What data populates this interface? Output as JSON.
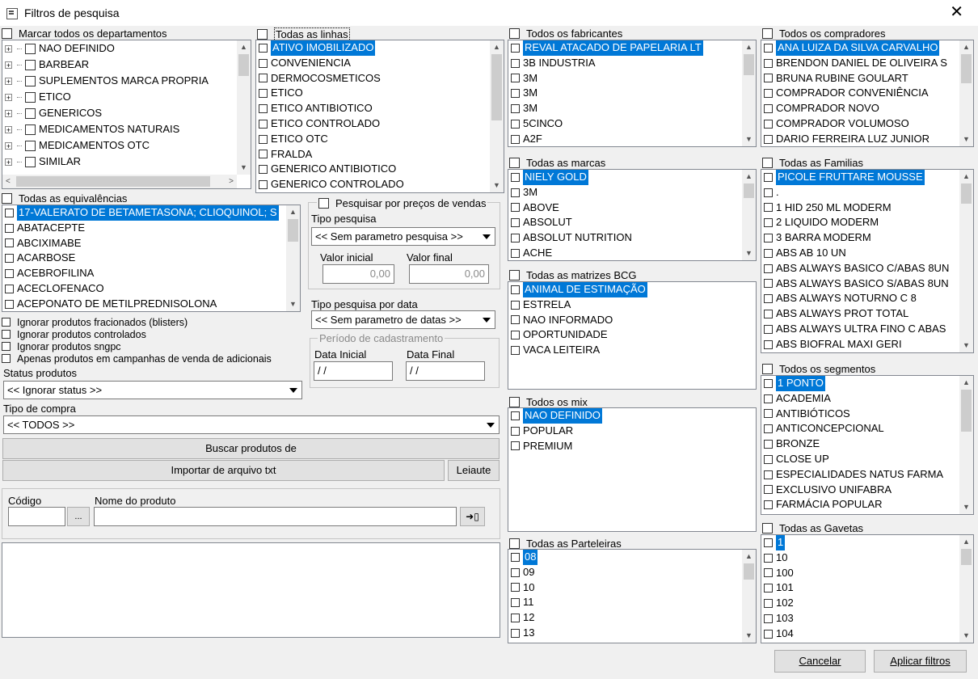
{
  "window": {
    "title": "Filtros de pesquisa"
  },
  "departamentos": {
    "header": "Marcar todos os departamentos",
    "items": [
      "NAO DEFINIDO",
      "BARBEAR",
      "SUPLEMENTOS MARCA PROPRIA",
      "ETICO",
      "GENERICOS",
      "MEDICAMENTOS NATURAIS",
      "MEDICAMENTOS OTC",
      "SIMILAR"
    ]
  },
  "linhas": {
    "header": "Todas as linhas",
    "items": [
      "ATIVO IMOBILIZADO",
      "CONVENIENCIA",
      "DERMOCOSMETICOS",
      "ETICO",
      "ETICO ANTIBIOTICO",
      "ETICO CONTROLADO",
      "ETICO OTC",
      "FRALDA",
      "GENERICO ANTIBIOTICO",
      "GENERICO CONTROLADO"
    ]
  },
  "fabricantes": {
    "header": "Todos os fabricantes",
    "items": [
      "REVAL ATACADO DE PAPELARIA LT",
      "3B INDUSTRIA",
      "3M",
      "3M",
      "3M",
      "5CINCO",
      "A2F"
    ]
  },
  "compradores": {
    "header": "Todos os compradores",
    "items": [
      "ANA LUIZA DA SILVA CARVALHO",
      "BRENDON DANIEL DE OLIVEIRA S",
      "BRUNA RUBINE GOULART",
      "COMPRADOR CONVENIÊNCIA",
      "COMPRADOR NOVO",
      "COMPRADOR VOLUMOSO",
      "DARIO FERREIRA LUZ JUNIOR"
    ]
  },
  "equivalencias": {
    "header": "Todas as equivalências",
    "items": [
      "17-VALERATO DE BETAMETASONA; CLIOQUINOL; S",
      "ABATACEPTE",
      "ABCIXIMABE",
      "ACARBOSE",
      "ACEBROFILINA",
      "ACECLOFENACO",
      "ACEPONATO DE METILPREDNISOLONA"
    ]
  },
  "precos": {
    "header": "Pesquisar por preços de vendas",
    "tipo_label": "Tipo pesquisa",
    "tipo_value": "<< Sem parametro pesquisa >>",
    "valor_inicial_label": "Valor inicial",
    "valor_final_label": "Valor final",
    "valor_inicial": "0,00",
    "valor_final": "0,00"
  },
  "data_pesquisa": {
    "tipo_label": "Tipo pesquisa por data",
    "tipo_value": "<< Sem parametro de datas >>",
    "periodo_label": "Período de cadastramento",
    "inicial_label": "Data Inicial",
    "final_label": "Data Final",
    "inicial": " / /",
    "final": " / /"
  },
  "opcoes": [
    "Ignorar produtos fracionados (blisters)",
    "Ignorar produtos controlados",
    "Ignorar produtos sngpc",
    "Apenas produtos em campanhas de venda de adicionais"
  ],
  "status": {
    "label": "Status produtos",
    "value": "<< Ignorar status >>"
  },
  "compra": {
    "label": "Tipo de compra",
    "value": "<< TODOS >>"
  },
  "buttons": {
    "buscar": "Buscar produtos de",
    "importar": "Importar de arquivo txt",
    "leiaute": "Leiaute",
    "cancelar": "Cancelar",
    "aplicar": "Aplicar filtros",
    "ellipsis": "..."
  },
  "produto": {
    "codigo_label": "Código",
    "nome_label": "Nome do produto",
    "codigo": "",
    "nome": ""
  },
  "marcas": {
    "header": "Todas as marcas",
    "items": [
      "NIELY GOLD",
      "3M",
      "ABOVE",
      "ABSOLUT",
      "ABSOLUT NUTRITION",
      "ACHE"
    ]
  },
  "familias": {
    "header": "Todas as Familias",
    "items": [
      "PICOLE FRUTTARE MOUSSE",
      ".",
      "1 HID 250 ML MODERM",
      "2 LIQUIDO MODERM",
      "3 BARRA MODERM",
      "ABS AB 10 UN",
      "ABS ALWAYS BASICO C/ABAS 8UN",
      "ABS ALWAYS BASICO S/ABAS 8UN",
      "ABS ALWAYS NOTURNO C 8",
      "ABS ALWAYS PROT TOTAL",
      "ABS ALWAYS ULTRA FINO C ABAS",
      "ABS BIOFRAL MAXI GERI"
    ]
  },
  "matrizes": {
    "header": "Todas as matrizes BCG",
    "items": [
      "ANIMAL DE ESTIMAÇÃO",
      "ESTRELA",
      "NAO INFORMADO",
      "OPORTUNIDADE",
      "VACA LEITEIRA"
    ]
  },
  "mix": {
    "header": "Todos os mix",
    "items": [
      "NAO DEFINIDO",
      "POPULAR",
      "PREMIUM"
    ]
  },
  "segmentos": {
    "header": "Todos os segmentos",
    "items": [
      "1 PONTO",
      "ACADEMIA",
      "ANTIBIÓTICOS",
      "ANTICONCEPCIONAL",
      "BRONZE",
      "CLOSE UP",
      "ESPECIALIDADES NATUS FARMA",
      "EXCLUSIVO UNIFABRA",
      "FARMÁCIA POPULAR"
    ]
  },
  "parteleiras": {
    "header": "Todas as Parteleiras",
    "items": [
      "08",
      "09",
      "10",
      "11",
      "12",
      "13"
    ]
  },
  "gavetas": {
    "header": "Todas as Gavetas",
    "items": [
      "1",
      "10",
      "100",
      "101",
      "102",
      "103",
      "104"
    ]
  }
}
